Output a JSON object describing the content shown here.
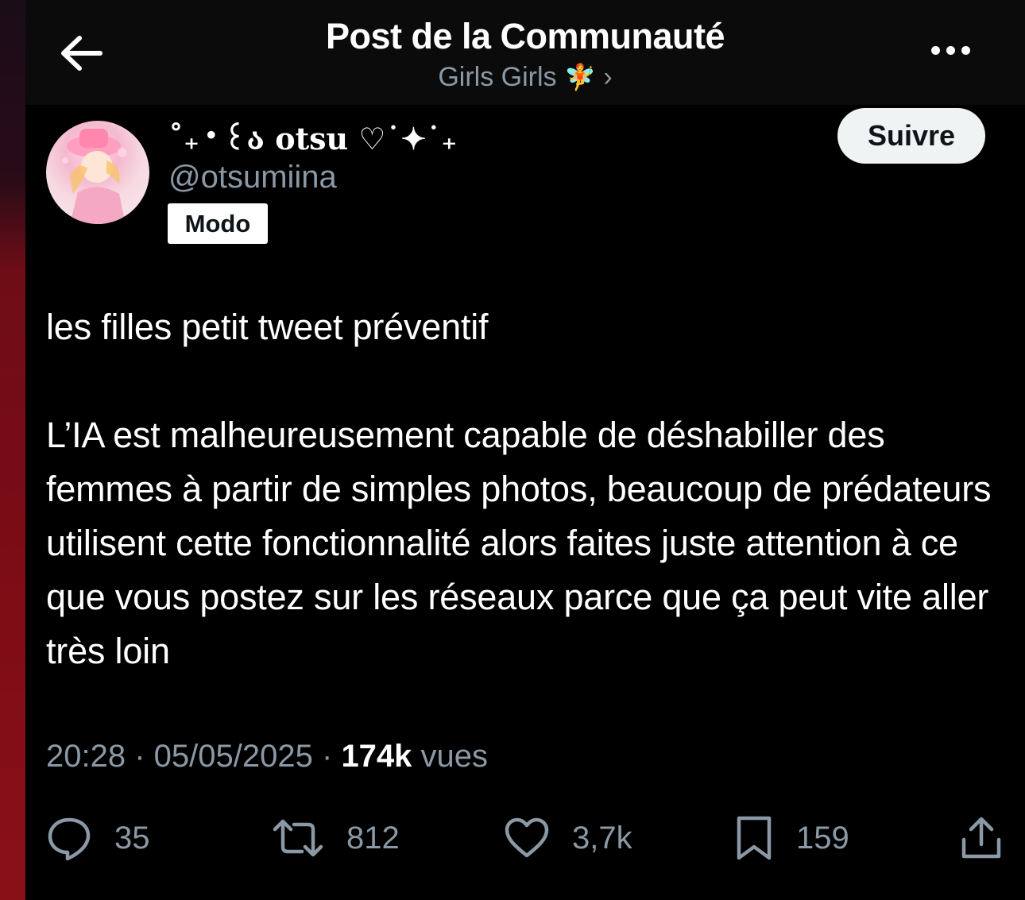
{
  "header": {
    "title": "Post de la Communauté",
    "community": "Girls Girls",
    "community_emoji": "🧚",
    "chevron": "›"
  },
  "author": {
    "display_name": "˚₊‧꒰ა otsu ♡˙✦˙₊",
    "handle": "@otsumiina",
    "badge": "Modo",
    "follow_label": "Suivre"
  },
  "post": {
    "line1": "les filles petit tweet préventif",
    "line2": "L’IA est malheureusement capable de déshabiller des femmes à partir de simples photos, beaucoup de prédateurs utilisent cette fonctionnalité alors faites juste attention à ce que vous postez sur les réseaux parce que ça peut vite aller très loin"
  },
  "meta": {
    "time": "20:28",
    "date": "05/05/2025",
    "views_count": "174k",
    "views_label": "vues"
  },
  "actions": {
    "replies": "35",
    "reposts": "812",
    "likes": "3,7k",
    "bookmarks": "159"
  },
  "icons": {
    "back": "arrow-left-icon",
    "more": "more-horizontal-icon",
    "reply": "reply-icon",
    "repost": "repost-icon",
    "like": "heart-icon",
    "bookmark": "bookmark-icon",
    "share": "share-icon"
  }
}
